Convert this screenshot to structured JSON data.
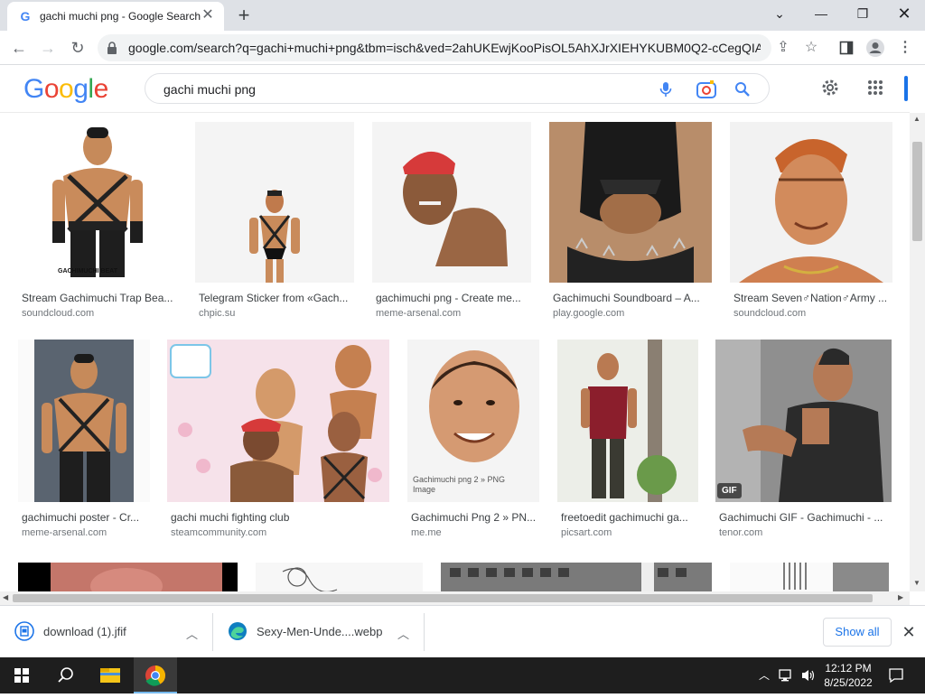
{
  "browser": {
    "tab_title": "gachi muchi png - Google Search",
    "new_tab_label": "+",
    "url": "google.com/search?q=gachi+muchi+png&tbm=isch&ved=2ahUKEwjKooPisOL5AhXJrXIEHYKUBM0Q2-cCegQIA..."
  },
  "google": {
    "logo": "Google",
    "query": "gachi muchi png"
  },
  "results": [
    {
      "caption": "Stream Gachimuchi Trap Bea...",
      "source": "soundcloud.com",
      "overlay": "GACHIMUCHI BEAT"
    },
    {
      "caption": "Telegram Sticker from «Gach...",
      "source": "chpic.su"
    },
    {
      "caption": "gachimuchi png - Create me...",
      "source": "meme-arsenal.com"
    },
    {
      "caption": "Gachimuchi Soundboard – A...",
      "source": "play.google.com"
    },
    {
      "caption": "Stream Seven♂Nation♂Army ...",
      "source": "soundcloud.com"
    },
    {
      "caption": "gachimuchi poster - Cr...",
      "source": "meme-arsenal.com"
    },
    {
      "caption": "gachi muchi fighting club",
      "source": "steamcommunity.com"
    },
    {
      "caption": "Gachimuchi Png 2 » PN...",
      "source": "me.me",
      "overlay": "Gachimuchi png 2 » PNG Image"
    },
    {
      "caption": "freetoedit gachimuchi ga...",
      "source": "picsart.com"
    },
    {
      "caption": "Gachimuchi GIF - Gachimuchi - ...",
      "source": "tenor.com",
      "badge": "GIF"
    }
  ],
  "downloads": [
    {
      "name": "download (1).jfif"
    },
    {
      "name": "Sexy-Men-Unde....webp"
    }
  ],
  "show_all_label": "Show all",
  "taskbar": {
    "time": "12:12 PM",
    "date": "8/25/2022"
  },
  "colors": {
    "accent": "#1a73e8",
    "logo_blue": "#4285f4",
    "logo_red": "#ea4335",
    "logo_yellow": "#fbbc05",
    "logo_green": "#34a853"
  },
  "icons": [
    "back-icon",
    "forward-icon",
    "reload-icon",
    "lock-icon",
    "share-icon",
    "star-icon",
    "sidebar-icon",
    "profile-icon",
    "menu-icon",
    "mic-icon",
    "lens-icon",
    "search-icon",
    "settings-icon",
    "apps-icon",
    "windows-start-icon",
    "search-taskbar-icon",
    "file-explorer-icon",
    "chrome-icon"
  ]
}
